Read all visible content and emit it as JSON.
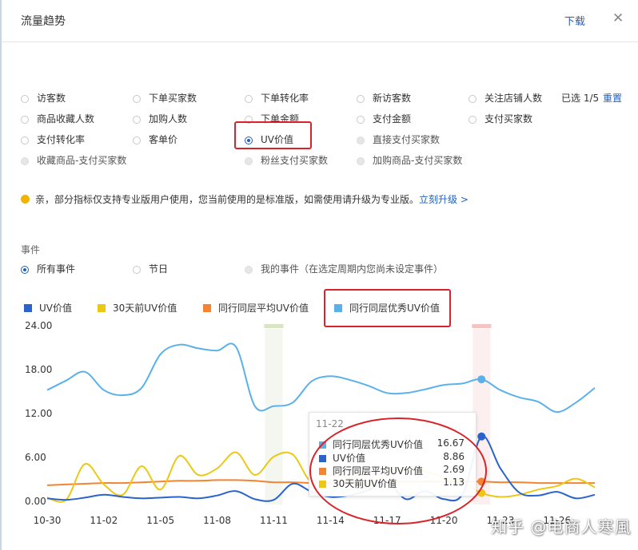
{
  "header": {
    "title": "流量趋势",
    "download": "下载",
    "close_icon": "close-icon"
  },
  "metrics": {
    "rows": [
      [
        {
          "label": "访客数",
          "state": "normal"
        },
        {
          "label": "下单买家数",
          "state": "normal"
        },
        {
          "label": "下单转化率",
          "state": "normal"
        },
        {
          "label": "新访客数",
          "state": "normal"
        },
        {
          "label": "关注店铺人数",
          "state": "normal"
        }
      ],
      [
        {
          "label": "商品收藏人数",
          "state": "normal"
        },
        {
          "label": "加购人数",
          "state": "normal"
        },
        {
          "label": "下单金额",
          "state": "normal"
        },
        {
          "label": "支付金额",
          "state": "normal"
        },
        {
          "label": "支付买家数",
          "state": "normal"
        }
      ],
      [
        {
          "label": "支付转化率",
          "state": "normal"
        },
        {
          "label": "客单价",
          "state": "normal"
        },
        {
          "label": "UV价值",
          "state": "selected"
        },
        {
          "label": "直接支付买家数",
          "state": "disabled"
        }
      ],
      [
        {
          "label": "收藏商品-支付买家数",
          "state": "disabled"
        },
        {
          "label": "粉丝支付买家数",
          "state": "disabled"
        },
        {
          "label": "加购商品-支付买家数",
          "state": "disabled"
        }
      ]
    ],
    "selected_count": "已选 1/5",
    "reset": "重置"
  },
  "notice": {
    "text": "亲，部分指标仅支持专业版用户使用，您当前使用的是标准版，如需使用请升级为专业版。",
    "link": "立刻升级 >"
  },
  "events": {
    "title": "事件",
    "options": [
      {
        "label": "所有事件",
        "state": "selected"
      },
      {
        "label": "节日",
        "state": "normal"
      },
      {
        "label": "我的事件（在选定周期内您尚未设定事件）",
        "state": "disabled"
      }
    ]
  },
  "chart_data": {
    "type": "line",
    "x": [
      "10-30",
      "10-31",
      "11-01",
      "11-02",
      "11-03",
      "11-04",
      "11-05",
      "11-06",
      "11-07",
      "11-08",
      "11-09",
      "11-10",
      "11-11",
      "11-12",
      "11-13",
      "11-14",
      "11-15",
      "11-16",
      "11-17",
      "11-18",
      "11-19",
      "11-20",
      "11-21",
      "11-22",
      "11-23",
      "11-24",
      "11-25",
      "11-26",
      "11-27",
      "11-28"
    ],
    "x_tick_labels": [
      "10-30",
      "11-02",
      "11-05",
      "11-08",
      "11-11",
      "11-14",
      "11-17",
      "11-20",
      "11-23",
      "11-26"
    ],
    "y_tick_labels": [
      "24.00",
      "18.00",
      "12.00",
      "6.00",
      "0.00"
    ],
    "ylim": [
      0,
      24
    ],
    "grid": "none",
    "legend_position": "top-left",
    "series": [
      {
        "name": "UV价值",
        "color": "#2a63c9",
        "values": [
          0.4,
          0.2,
          0.5,
          0.9,
          0.6,
          0.4,
          0.5,
          0.6,
          0.4,
          0.8,
          1.4,
          0.3,
          0.2,
          2.4,
          1.3,
          0.6,
          0.8,
          1.5,
          2.6,
          0.3,
          1.4,
          0.3,
          1.0,
          8.86,
          4.5,
          1.2,
          0.8,
          1.3,
          0.4,
          0.9
        ]
      },
      {
        "name": "30天前UV价值",
        "color": "#ecc815",
        "values": [
          0.5,
          0.2,
          5.1,
          2.3,
          0.9,
          4.8,
          1.6,
          6.2,
          3.6,
          4.5,
          6.7,
          3.6,
          6.1,
          6.4,
          2.6,
          3.6,
          3.1,
          1.8,
          3.9,
          4.6,
          4.1,
          3.3,
          2.6,
          1.13,
          0.6,
          0.9,
          1.6,
          2.1,
          3.1,
          1.9
        ]
      },
      {
        "name": "同行同层平均UV价值",
        "color": "#f28434",
        "values": [
          2.2,
          2.3,
          2.4,
          2.5,
          2.5,
          2.6,
          2.7,
          2.8,
          2.8,
          2.9,
          2.9,
          2.8,
          2.6,
          2.6,
          2.5,
          2.5,
          2.6,
          2.7,
          2.7,
          2.7,
          2.7,
          2.7,
          2.7,
          2.69,
          2.6,
          2.6,
          2.5,
          2.5,
          2.5,
          2.5
        ]
      },
      {
        "name": "同行同层优秀UV价值",
        "color": "#5ab1e9",
        "values": [
          15.2,
          16.5,
          17.7,
          15.2,
          14.5,
          15.5,
          20.1,
          21.4,
          20.9,
          20.6,
          21.1,
          13.0,
          13.0,
          13.5,
          16.4,
          17.1,
          16.6,
          15.8,
          14.8,
          14.8,
          15.3,
          15.9,
          16.1,
          16.67,
          15.2,
          14.2,
          13.6,
          12.2,
          13.5,
          15.5
        ]
      }
    ],
    "event_markers": [
      {
        "x": "11-11",
        "color": "#d8e4c4"
      },
      {
        "x": "11-22",
        "color": "#f2c4c4"
      }
    ],
    "tooltip": {
      "date": "11-22",
      "rows": [
        {
          "name": "同行同层优秀UV价值",
          "value": "16.67",
          "color": "#5ab1e9"
        },
        {
          "name": "UV价值",
          "value": "8.86",
          "color": "#2a63c9"
        },
        {
          "name": "同行同层平均UV价值",
          "value": "2.69",
          "color": "#f28434"
        },
        {
          "name": "30天前UV价值",
          "value": "1.13",
          "color": "#ecc815"
        }
      ]
    }
  },
  "watermark": "知乎 @电商人寒風",
  "colors": {
    "link": "#1f5fbf",
    "annotation": "#d9232a"
  }
}
